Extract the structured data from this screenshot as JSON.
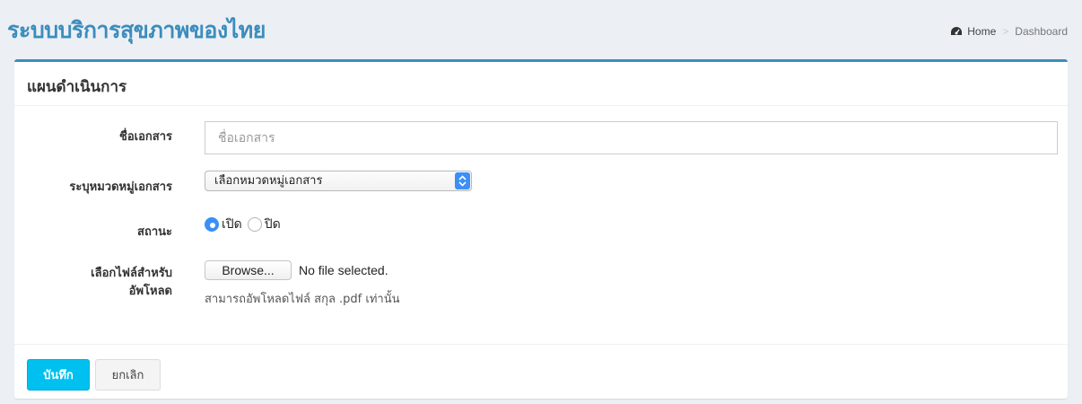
{
  "header": {
    "title": "ระบบบริการสุขภาพของไทย",
    "breadcrumb": {
      "home": "Home",
      "current": "Dashboard"
    }
  },
  "box": {
    "title": "แผนดำเนินการ"
  },
  "form": {
    "doc_name_label": "ชื่อเอกสาร",
    "doc_name_placeholder": "ชื่อเอกสาร",
    "doc_name_value": "",
    "category_label": "ระบุหมวดหมู่เอกสาร",
    "category_selected": "เลือกหมวดหมู่เอกสาร",
    "status_label": "สถานะ",
    "status_options": [
      {
        "label": "เปิด",
        "checked": true
      },
      {
        "label": "ปิด",
        "checked": false
      }
    ],
    "upload_label_line1": "เลือกไฟล์สำหรับ",
    "upload_label_line2": "อัพโหลด",
    "browse_label": "Browse...",
    "file_status": "No file selected.",
    "upload_help": "สามารถอัพโหลดไฟล์ สกุล .pdf เท่านั้น"
  },
  "footer": {
    "save_label": "บันทึก",
    "cancel_label": "ยกเลิก"
  },
  "colors": {
    "accent": "#3c8dbc",
    "save_button": "#00c0ef",
    "radio_checked": "#3b8ff6"
  },
  "icons": {
    "breadcrumb_home": "dashboard-icon",
    "select_arrow": "updown-chevron-icon"
  }
}
